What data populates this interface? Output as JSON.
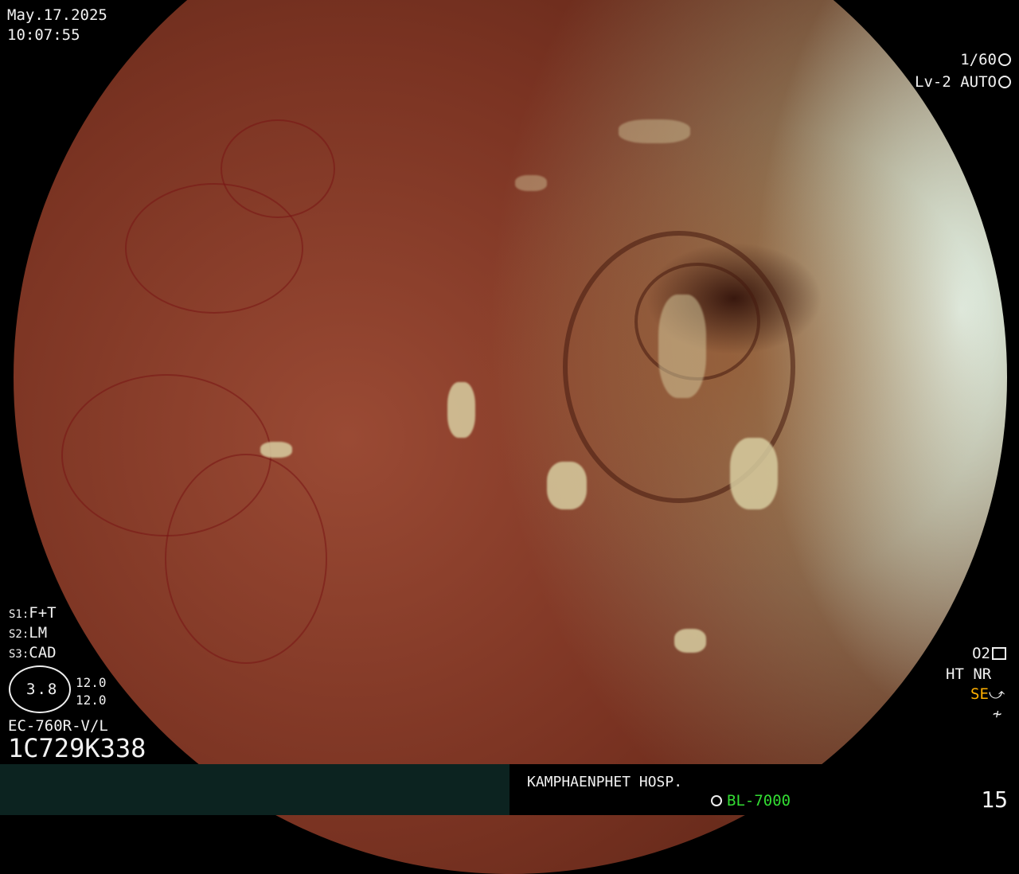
{
  "header": {
    "date": "May.17.2025",
    "time": "10:07:55"
  },
  "exposure": {
    "shutter": "1/60",
    "shutter_icon": "aperture-icon",
    "level": "Lv-2",
    "mode": "AUTO",
    "mode_icon": "iris-icon"
  },
  "settings": {
    "s1_label": "S1:",
    "s1_value": "F+T",
    "s2_label": "S2:",
    "s2_value": "LM",
    "s3_label": "S3:",
    "s3_value": "CAD"
  },
  "scope": {
    "zoom_value": "3.8",
    "value_a": "12.0",
    "value_b": "12.0",
    "model": "EC-760R-V/L",
    "serial": "1C729K338"
  },
  "status_right": {
    "o2": "O2",
    "o2_icon": "sliders-icon",
    "ht": "HT",
    "nr": "NR",
    "se": "SE",
    "se_icon": "curve-icon",
    "bottom_icon": "lightning-icon"
  },
  "footer": {
    "hospital": "KAMPHAENPHET HOSP.",
    "light_source": "BL-7000",
    "light_icon": "sun-icon",
    "frame_number": "15",
    "colors": {
      "left_bar": "#0c2320",
      "light_source_text": "#33dd33",
      "se_text": "#ffb000"
    }
  }
}
